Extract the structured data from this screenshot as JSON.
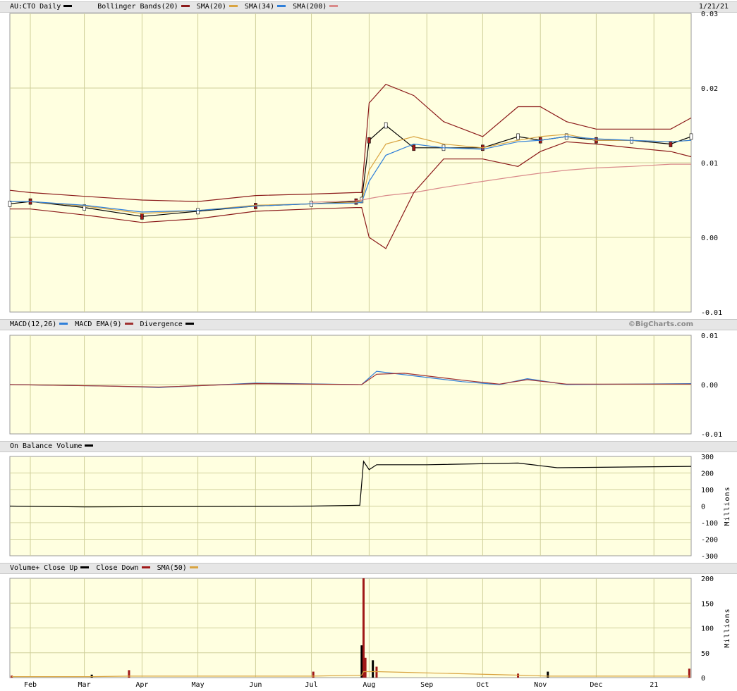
{
  "header": {
    "title": "AU:CTO Daily",
    "legend": [
      {
        "label": "Bollinger Bands(20)",
        "color": "#8b1a1a"
      },
      {
        "label": "SMA(20)",
        "color": "#d9a441"
      },
      {
        "label": "SMA(34)",
        "color": "#2f7fd9"
      },
      {
        "label": "SMA(200)",
        "color": "#d98a8a"
      }
    ],
    "date": "1/21/21"
  },
  "macd_header": {
    "legend": [
      {
        "label": "MACD(12,26)",
        "color": "#2f7fd9"
      },
      {
        "label": "MACD EMA(9)",
        "color": "#a03030"
      },
      {
        "label": "Divergence",
        "color": "#000000"
      }
    ],
    "brand": "©BigCharts.com"
  },
  "obv_header": {
    "legend": [
      {
        "label": "On Balance Volume",
        "color": "#000000"
      }
    ]
  },
  "vol_header": {
    "legend": [
      {
        "label": "Volume+ Close Up",
        "color": "#000000"
      },
      {
        "label": "Close Down",
        "color": "#a01818"
      },
      {
        "label": "SMA(50)",
        "color": "#d9a441"
      }
    ]
  },
  "x_axis": {
    "labels": [
      "Feb",
      "Mar",
      "Apr",
      "May",
      "Jun",
      "Jul",
      "Aug",
      "Sep",
      "Oct",
      "Nov",
      "Dec",
      "21"
    ]
  },
  "chart_data": [
    {
      "type": "line",
      "panel": "price",
      "title": "AU:CTO Daily",
      "yticks": [
        "0.03",
        "0.02",
        "0.01",
        "0.00",
        "-0.01"
      ],
      "ylim": [
        -0.01,
        0.03
      ],
      "x": [
        "2020-01-21",
        "2020-02-01",
        "2020-03-01",
        "2020-04-01",
        "2020-05-01",
        "2020-06-01",
        "2020-07-01",
        "2020-07-25",
        "2020-07-28",
        "2020-08-01",
        "2020-08-10",
        "2020-08-25",
        "2020-09-10",
        "2020-10-01",
        "2020-10-20",
        "2020-11-01",
        "2020-11-15",
        "2020-12-01",
        "2020-12-20",
        "2021-01-10",
        "2021-01-21"
      ],
      "series": [
        {
          "name": "Close",
          "values": [
            0.0045,
            0.0048,
            0.004,
            0.0028,
            0.0035,
            0.0042,
            0.0045,
            0.0048,
            0.005,
            0.013,
            0.015,
            0.012,
            0.012,
            0.012,
            0.0135,
            0.013,
            0.0135,
            0.013,
            0.013,
            0.0125,
            0.0135
          ]
        },
        {
          "name": "SMA(20)",
          "values": [
            0.0048,
            0.0048,
            0.0042,
            0.0032,
            0.0036,
            0.0043,
            0.0045,
            0.0047,
            0.0048,
            0.009,
            0.0125,
            0.0135,
            0.0125,
            0.012,
            0.013,
            0.0135,
            0.0138,
            0.013,
            0.013,
            0.0128,
            0.013
          ]
        },
        {
          "name": "SMA(34)",
          "values": [
            0.0048,
            0.0048,
            0.0043,
            0.0034,
            0.0036,
            0.0042,
            0.0045,
            0.0046,
            0.0047,
            0.0075,
            0.011,
            0.0125,
            0.012,
            0.0118,
            0.0128,
            0.013,
            0.0135,
            0.0132,
            0.013,
            0.0128,
            0.013
          ]
        },
        {
          "name": "SMA(200)",
          "values": [
            null,
            null,
            null,
            null,
            null,
            null,
            0.0047,
            0.0049,
            0.005,
            0.0052,
            0.0056,
            0.006,
            0.0067,
            0.0075,
            0.0082,
            0.0086,
            0.009,
            0.0093,
            0.0095,
            0.0098,
            0.0098
          ]
        },
        {
          "name": "BB Upper",
          "values": [
            0.0063,
            0.006,
            0.0055,
            0.005,
            0.0048,
            0.0056,
            0.0058,
            0.006,
            0.006,
            0.018,
            0.0205,
            0.019,
            0.0155,
            0.0135,
            0.0175,
            0.0175,
            0.0155,
            0.0145,
            0.0145,
            0.0145,
            0.016
          ]
        },
        {
          "name": "BB Lower",
          "values": [
            0.0038,
            0.0038,
            0.003,
            0.002,
            0.0025,
            0.0035,
            0.0038,
            0.004,
            0.004,
            0.0,
            -0.0015,
            0.006,
            0.0105,
            0.0105,
            0.0095,
            0.0115,
            0.0128,
            0.0125,
            0.012,
            0.0115,
            0.0108
          ]
        }
      ]
    },
    {
      "type": "line",
      "panel": "macd",
      "yticks": [
        "0.01",
        "0.00",
        "-0.01"
      ],
      "ylim": [
        -0.01,
        0.01
      ],
      "x": [
        "2020-01-21",
        "2020-03-15",
        "2020-04-10",
        "2020-06-01",
        "2020-07-28",
        "2020-08-05",
        "2020-08-20",
        "2020-09-20",
        "2020-10-10",
        "2020-10-25",
        "2020-11-15",
        "2021-01-21"
      ],
      "series": [
        {
          "name": "MACD(12,26)",
          "values": [
            0.0,
            -0.0003,
            -0.0006,
            0.0003,
            0.0,
            0.0027,
            0.002,
            0.0006,
            0.0,
            0.0012,
            0.0,
            0.0002
          ]
        },
        {
          "name": "MACD EMA(9)",
          "values": [
            0.0,
            -0.0003,
            -0.0005,
            0.0002,
            0.0,
            0.0021,
            0.0023,
            0.0009,
            0.0001,
            0.001,
            0.0001,
            0.0001
          ]
        }
      ]
    },
    {
      "type": "line",
      "panel": "obv",
      "ylabel": "Millions",
      "yticks": [
        "300",
        "200",
        "100",
        "0",
        "-100",
        "-200",
        "-300"
      ],
      "ylim": [
        -300,
        300
      ],
      "x": [
        "2020-01-21",
        "2020-03-01",
        "2020-07-01",
        "2020-07-27",
        "2020-07-29",
        "2020-08-01",
        "2020-08-05",
        "2020-09-01",
        "2020-10-20",
        "2020-11-10",
        "2021-01-21"
      ],
      "series": [
        {
          "name": "On Balance Volume",
          "values": [
            0,
            -5,
            0,
            5,
            270,
            220,
            250,
            250,
            260,
            232,
            240
          ]
        }
      ]
    },
    {
      "type": "bar",
      "panel": "volume",
      "ylabel": "Millions",
      "yticks": [
        "200",
        "150",
        "100",
        "50",
        "0"
      ],
      "ylim": [
        0,
        200
      ],
      "categories": [
        "2020-01-22",
        "2020-03-05",
        "2020-03-25",
        "2020-07-02",
        "2020-07-28",
        "2020-07-29",
        "2020-07-30",
        "2020-08-03",
        "2020-08-05",
        "2020-10-20",
        "2020-11-05",
        "2021-01-20"
      ],
      "series": [
        {
          "name": "Volume",
          "values": [
            4,
            6,
            15,
            12,
            65,
            200,
            40,
            35,
            22,
            8,
            12,
            18
          ]
        },
        {
          "name": "SMA(50)",
          "values": [
            2,
            2,
            3,
            3,
            5,
            12,
            12,
            12,
            12,
            5,
            3,
            3
          ]
        }
      ]
    }
  ]
}
